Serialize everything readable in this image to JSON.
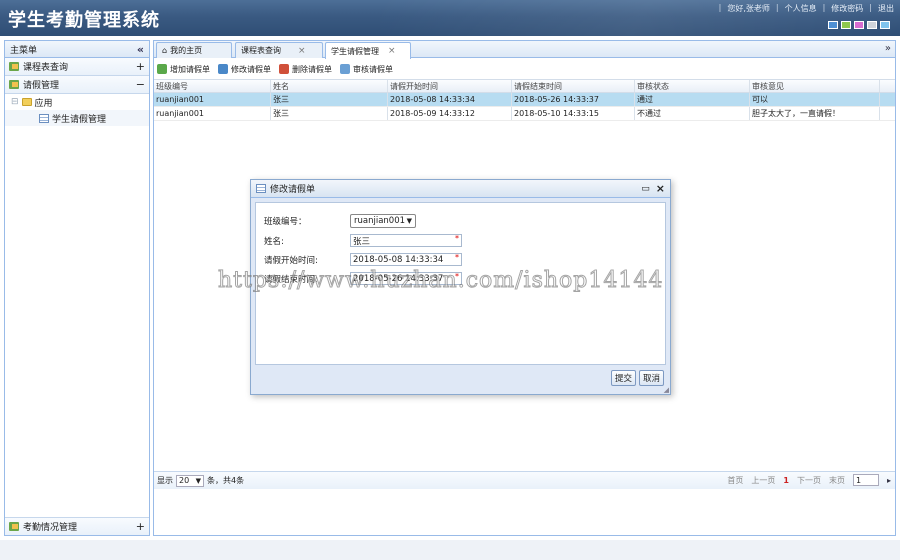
{
  "app": {
    "title": "学生考勤管理系统"
  },
  "top_links": [
    "您好,张老师",
    "个人信息",
    "修改密码",
    "退出"
  ],
  "theme_colors": [
    "#4a8ed4",
    "#8cc64a",
    "#d86ad0",
    "#cfd3da",
    "#7fc4ee"
  ],
  "sidebar": {
    "header": "主菜单",
    "sections": [
      {
        "label": "课程表查询",
        "toggle": "+"
      },
      {
        "label": "请假管理",
        "toggle": "−"
      }
    ],
    "tree": {
      "folder": "应用",
      "leaf": "学生请假管理"
    },
    "bottom_section": {
      "label": "考勤情况管理",
      "toggle": "+"
    }
  },
  "tabs": [
    {
      "label": "我的主页"
    },
    {
      "label": "课程表查询"
    },
    {
      "label": "学生请假管理"
    }
  ],
  "toolbar": {
    "add": "增加请假单",
    "edit": "修改请假单",
    "delete": "删除请假单",
    "review": "审核请假单"
  },
  "grid": {
    "columns": [
      "班级编号",
      "姓名",
      "请假开始时间",
      "请假结束时间",
      "审核状态",
      "审核意见"
    ],
    "rows": [
      [
        "ruanjian001",
        "张三",
        "2018-05-08 14:33:34",
        "2018-05-26 14:33:37",
        "通过",
        "可以"
      ],
      [
        "ruanjian001",
        "张三",
        "2018-05-09 14:33:12",
        "2018-05-10 14:33:15",
        "不通过",
        "胆子太大了，一直请假！"
      ]
    ]
  },
  "pager": {
    "show_label": "显示",
    "page_size": "20",
    "summary": "条，共4条",
    "first": "首页",
    "prev": "上一页",
    "current": "1",
    "next": "下一页",
    "last": "末页",
    "page_input": "1"
  },
  "dialog": {
    "title": "修改请假单",
    "fields": {
      "class_label": "班级编号：",
      "class_value": "ruanjian001",
      "name_label": "姓名:",
      "name_value": "张三",
      "start_label": "请假开始时间:",
      "start_value": "2018-05-08 14:33:34",
      "end_label": "请假结束时间:",
      "end_value": "2018-05-26 14:33:37",
      "required_mark": "*"
    },
    "submit": "提交",
    "cancel": "取消"
  },
  "watermark": "https://www.huzhan.com/ishop14144"
}
